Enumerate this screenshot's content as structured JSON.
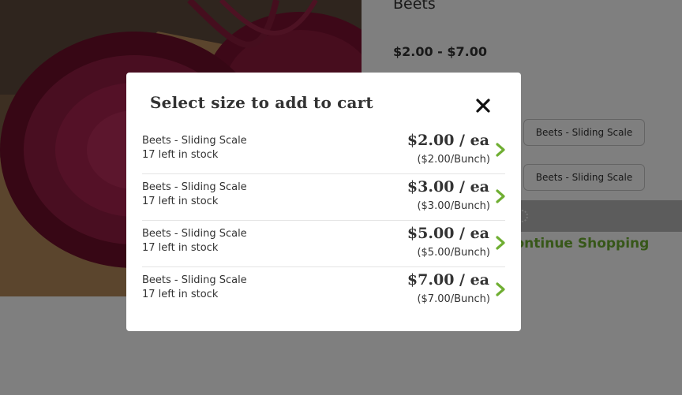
{
  "product": {
    "title": "Beets",
    "price_range": "$2.00 - $7.00",
    "size_option_label": "Beets - Sliding Scale",
    "continue_label": "Continue Shopping",
    "image": "beets-photo"
  },
  "modal": {
    "title": "Select size to add to cart",
    "close_icon": "close-icon",
    "rows": [
      {
        "name": "Beets - Sliding Scale",
        "stock": "17 left in stock",
        "price": "$2.00 / ea",
        "unit_price": "($2.00/Bunch)"
      },
      {
        "name": "Beets - Sliding Scale",
        "stock": "17 left in stock",
        "price": "$3.00 / ea",
        "unit_price": "($3.00/Bunch)"
      },
      {
        "name": "Beets - Sliding Scale",
        "stock": "17 left in stock",
        "price": "$5.00 / ea",
        "unit_price": "($5.00/Bunch)"
      },
      {
        "name": "Beets - Sliding Scale",
        "stock": "17 left in stock",
        "price": "$7.00 / ea",
        "unit_price": "($7.00/Bunch)"
      }
    ]
  },
  "colors": {
    "accent_green": "#6fae32",
    "overlay": "rgba(0,0,0,0.5)",
    "text": "#333333"
  }
}
